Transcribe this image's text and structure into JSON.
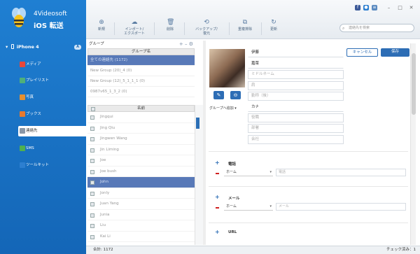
{
  "app": {
    "brand": "4Videosoft",
    "product": "iOS 転送",
    "accent": "#1f7fd2"
  },
  "device": {
    "name": "iPhone 4",
    "badge": "A"
  },
  "sidebar": {
    "items": [
      {
        "label": "メディア",
        "icon": "music-icon",
        "color": "#e8473a"
      },
      {
        "label": "プレイリスト",
        "icon": "playlist-icon",
        "color": "#4fb07a"
      },
      {
        "label": "写真",
        "icon": "photo-icon",
        "color": "#e8902f"
      },
      {
        "label": "ブックス",
        "icon": "books-icon",
        "color": "#e87a2f"
      },
      {
        "label": "連絡先",
        "icon": "contacts-icon",
        "color": "#8a98a8"
      },
      {
        "label": "SMS",
        "icon": "sms-icon",
        "color": "#4fb04f"
      },
      {
        "label": "ツールキット",
        "icon": "toolkit-icon",
        "color": "#2d7fd0"
      }
    ]
  },
  "toolbar": {
    "new": "新規",
    "import_export": [
      "インポート/",
      "エクスポート"
    ],
    "delete": "削除",
    "backup_restore": [
      "バックアップ/",
      "復元"
    ],
    "dedupe": "重複排除",
    "refresh": "更新",
    "search_placeholder": "連絡先を検索"
  },
  "groups": {
    "header": "グループ",
    "column": "グループ名",
    "rows": [
      "全ての連絡先 (1172)",
      "New Group (20)_4 (0)",
      "New Group (12)_5_1_1_1 (0)",
      "0987v65_1_3_2 (0)"
    ]
  },
  "contacts": {
    "column": "名前",
    "rows": [
      "Jingqui",
      "Jing Qiu",
      "Jingwen Wang",
      "Jin Liming",
      "Joe",
      "Joe bush",
      "John",
      "Jonly",
      "Juan Yang",
      "Junia",
      "Liu",
      "Kai Li"
    ]
  },
  "detail": {
    "group_select": "グループへ追加",
    "fields": {
      "last_name": "伊藤",
      "first_name": "嘉菜",
      "middle_name": "ミドルネーム",
      "title": "肩",
      "pronunciation": "勤称（後）",
      "kana": "カナ",
      "company_role": "役職",
      "department": "部署",
      "company": "会社"
    },
    "cancel": "キャンセル",
    "save": "保存",
    "phone_section": "電話",
    "phone_type": "ホーム",
    "phone_placeholder": "電話",
    "mail_section": "メール",
    "mail_type": "ホーム",
    "mail_placeholder": "メール",
    "url_section": "URL"
  },
  "status": {
    "total": "合計: 1172",
    "checked": "チェック済み：1"
  }
}
